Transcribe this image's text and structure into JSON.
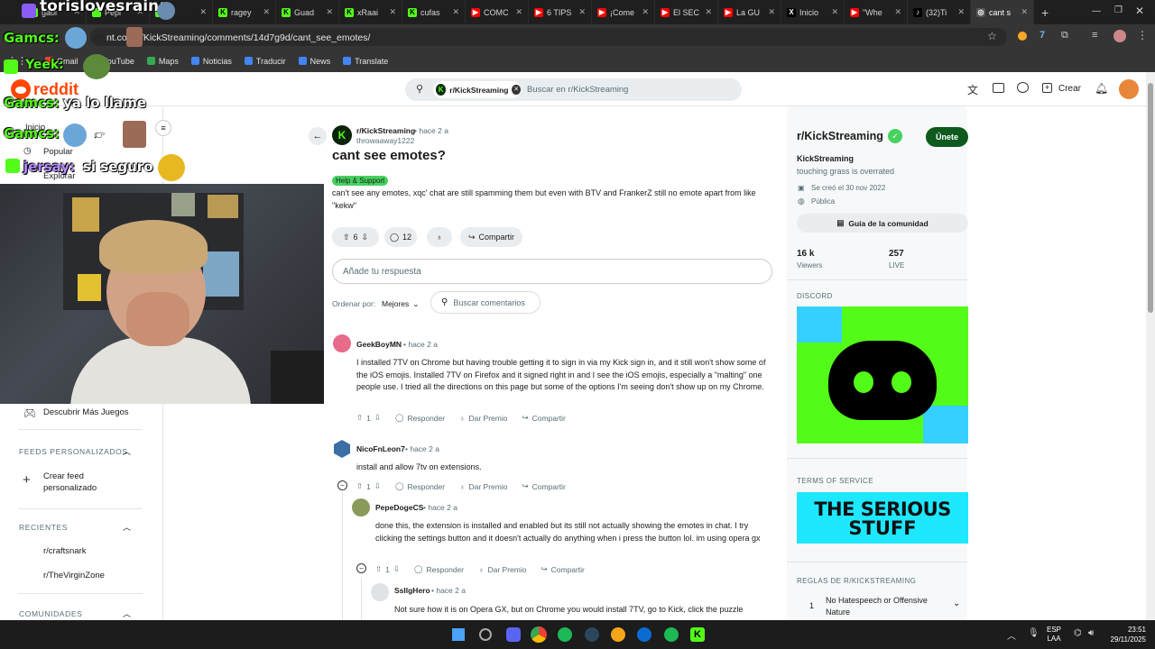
{
  "browser": {
    "tabs": [
      {
        "label": "gaol",
        "color": "#53fc18",
        "letter": ""
      },
      {
        "label": "Pepi",
        "color": "#53fc18",
        "letter": ""
      },
      {
        "label": "",
        "color": "#53fc18",
        "letter": ""
      },
      {
        "label": "ragey",
        "color": "#53fc18",
        "letter": "K"
      },
      {
        "label": "Guad",
        "color": "#53fc18",
        "letter": "K"
      },
      {
        "label": "xRaai",
        "color": "#53fc18",
        "letter": "K"
      },
      {
        "label": "cufas",
        "color": "#53fc18",
        "letter": "K"
      },
      {
        "label": "COMC",
        "color": "#ff0000",
        "letter": "▶"
      },
      {
        "label": "6 TIPS",
        "color": "#ff0000",
        "letter": "▶"
      },
      {
        "label": "¡Come",
        "color": "#ff0000",
        "letter": "▶"
      },
      {
        "label": "El SEC",
        "color": "#ff0000",
        "letter": "▶"
      },
      {
        "label": "La GU",
        "color": "#ff0000",
        "letter": "▶"
      },
      {
        "label": "Inicio",
        "color": "#000000",
        "letter": "X"
      },
      {
        "label": "\"Whe",
        "color": "#ff0000",
        "letter": "▶"
      },
      {
        "label": "(32)Ti",
        "color": "#000000",
        "letter": "♪"
      },
      {
        "label": "cant s",
        "color": "#555555",
        "letter": "◎"
      }
    ],
    "url": "nt.com/r/KickStreaming/comments/14d7g9d/cant_see_emotes/",
    "bookmarks": [
      {
        "label": "Gmail",
        "color": "#ea4335"
      },
      {
        "label": "YouTube",
        "color": "#ff0000"
      },
      {
        "label": "Maps",
        "color": "#34a853"
      },
      {
        "label": "Noticias",
        "color": "#4285f4"
      },
      {
        "label": "Traducir",
        "color": "#4285f4"
      },
      {
        "label": "News",
        "color": "#4285f4"
      },
      {
        "label": "Translate",
        "color": "#4285f4"
      }
    ]
  },
  "overlay": {
    "chat_lines": [
      {
        "user": "torislovesrain:",
        "msg": ""
      },
      {
        "user": "Gamcs:",
        "msg": ""
      },
      {
        "user": "Yeek:",
        "msg": ""
      },
      {
        "user": "Gamcs:",
        "msg": "ya lo llame"
      },
      {
        "user": "Gamcs:",
        "msg": ""
      },
      {
        "user": "jersay:",
        "msg": "si seguro"
      }
    ]
  },
  "reddit": {
    "logo_text": "reddit",
    "search": {
      "chip": "r/KickStreaming",
      "placeholder": "Buscar en r/KickStreaming"
    },
    "header_actions": {
      "create": "Crear"
    },
    "sidebar": {
      "nav": [
        "Inicio",
        "Popular",
        "Explorar"
      ],
      "games": "Descubrir Más Juegos",
      "feeds_title": "FEEDS PERSONALIZADOS",
      "create_feed": "Crear feed personalizado",
      "recent_title": "RECIENTES",
      "recent": [
        "r/craftsnark",
        "r/TheVirginZone"
      ],
      "communities_title": "COMUNIDADES"
    },
    "post": {
      "subreddit": "r/KickStreaming",
      "time": "• hace 2 a",
      "author": "throwaaway1222",
      "title": "cant see emotes?",
      "flair": "Help & Support",
      "body": "can't see any emotes, xqc' chat are still spamming them but even with BTV and FrankerZ still no emote apart from like \"kekw\"",
      "votes": "6",
      "comments": "12",
      "share": "Compartir",
      "reply_placeholder": "Añade tu respuesta",
      "sort_label": "Ordenar por:",
      "sort_value": "Mejores",
      "search_comments": "Buscar comentarios"
    },
    "comments": [
      {
        "author": "GeekBoyMN",
        "time": "• hace 2 a",
        "text": "I installed 7TV on Chrome but having trouble getting it to sign in via my Kick sign in, and it still won't show some of the iOS emojis. Installed 7TV on Firefox and it signed right in and I see the iOS emojis, especially a \"malting\" one people use. I tried all the directions on this page but some of the options I'm seeing don't show up on my Chrome.",
        "votes": "1",
        "avatar": "#e86b8a"
      },
      {
        "author": "NicoFnLeon7",
        "time": "• hace 2 a",
        "text": "install and allow 7tv on extensions.",
        "votes": "1",
        "avatar": "#3a6ea5"
      },
      {
        "author": "PepeDogeCS",
        "time": "• hace 2 a",
        "text": "done this, the extension is installed and enabled but its still not actually showing the emotes in chat. I try clicking the settings button and it doesn't actually do anything when i press the button lol. im using opera gx",
        "votes": "1",
        "avatar": "#8a9a5b"
      },
      {
        "author": "SsllgHero",
        "time": "• hace 2 a",
        "text": "Not sure how it is on Opera GX, but on Chrome you would install 7TV, go to Kick, click the puzzle",
        "votes": "",
        "avatar": "#dfe3e6"
      }
    ],
    "comment_actions": {
      "reply": "Responder",
      "award": "Dar Premio",
      "share": "Compartir"
    },
    "rail": {
      "name": "r/KickStreaming",
      "join": "Únete",
      "title": "KickStreaming",
      "desc": "touching grass is overrated",
      "created": "Se creó el 30 nov 2022",
      "visibility": "Pública",
      "guide": "Guía de la comunidad",
      "stat1_value": "16 k",
      "stat1_label": "Viewers",
      "stat2_value": "257",
      "stat2_label": "LIVE",
      "discord_label": "DISCORD",
      "tos_label": "TERMS OF SERVICE",
      "tos_image_text_1": "THE SERIOUS",
      "tos_image_text_2": "STUFF",
      "rules_label": "REGLAS DE R/KICKSTREAMING",
      "rule1_num": "1",
      "rule1_text": "No Hatespeech or Offensive Nature"
    }
  },
  "taskbar": {
    "lang1": "ESP",
    "lang2": "LAA",
    "time": "23:51",
    "date": "29/11/2025"
  },
  "colors": {
    "kick_green": "#53fc18",
    "reddit_orange": "#ff4500",
    "join_btn": "#0e5a1d",
    "flair": "#46d160"
  }
}
